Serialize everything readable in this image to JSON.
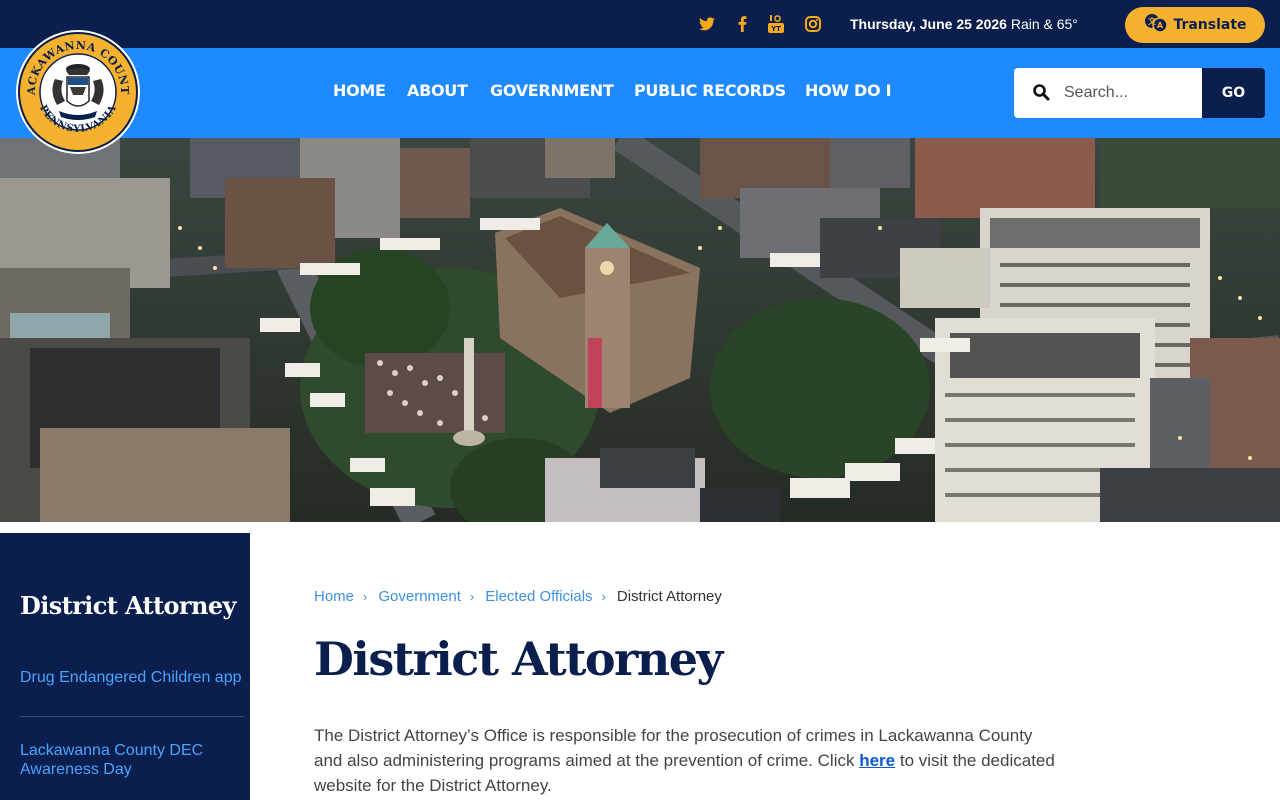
{
  "topbar": {
    "social": [
      "twitter-icon",
      "facebook-icon",
      "youtube-icon",
      "instagram-icon"
    ],
    "date": "Thursday, June 25 2026",
    "weather": "Rain & 65°",
    "translate_label": "Translate"
  },
  "seal": {
    "text_top": "LACKAWANNA COUNTY",
    "text_bottom": "PENNSYLVANIA"
  },
  "nav": {
    "items": [
      "HOME",
      "ABOUT",
      "GOVERNMENT",
      "PUBLIC RECORDS",
      "HOW DO I"
    ],
    "search_placeholder": "Search...",
    "go_label": "GO"
  },
  "sidebar": {
    "title": "District Attorney",
    "links": [
      "Drug Endangered Children app",
      "Lackawanna County DEC Awareness Day"
    ]
  },
  "breadcrumb": {
    "items": [
      "Home",
      "Government",
      "Elected Officials"
    ],
    "current": "District Attorney"
  },
  "main": {
    "title": "District Attorney",
    "text_before": "The District Attorney’s Office is responsible for the prosecution of crimes in Lackawanna County and also administering programs aimed at the prevention of crime. Click ",
    "link_text": "here",
    "text_after": " to visit the dedicated website for the District Attorney."
  },
  "colors": {
    "dark_navy": "#0a1f4d",
    "nav_blue": "#1f8aff",
    "accent_gold": "#f6b12e",
    "link_blue": "#3f8fe0"
  }
}
